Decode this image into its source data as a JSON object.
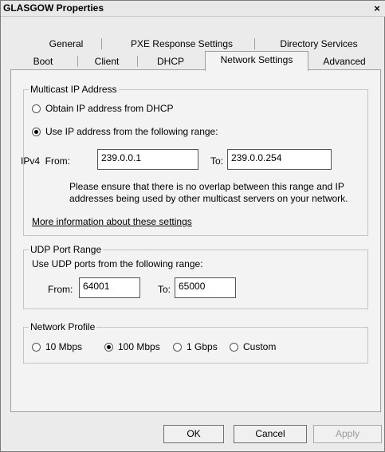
{
  "window": {
    "title": "GLASGOW Properties",
    "close_glyph": "×"
  },
  "tabs_row1": [
    {
      "label": "General"
    },
    {
      "label": "PXE Response Settings"
    },
    {
      "label": "Directory Services"
    }
  ],
  "tabs_row2": [
    {
      "label": "Boot"
    },
    {
      "label": "Client"
    },
    {
      "label": "DHCP"
    },
    {
      "label": "Network Settings",
      "active": true
    },
    {
      "label": "Advanced"
    }
  ],
  "multicast": {
    "title": "Multicast IP Address",
    "option_dhcp": "Obtain IP address from DHCP",
    "option_range": "Use IP address from the following range:",
    "selected": "range",
    "ipv4_from_label": "IPv4  From:",
    "from_value": "239.0.0.1",
    "to_label": "To:",
    "to_value": "239.0.0.254",
    "note": "Please ensure that there is no overlap between this range and IP addresses being used by other multicast servers on your network.",
    "more_info_link": "More information about these settings"
  },
  "udp": {
    "title": "UDP Port Range",
    "instruction": "Use UDP ports from the following range:",
    "from_label": "From:",
    "from_value": "64001",
    "to_label": "To:",
    "to_value": "65000"
  },
  "profile": {
    "title": "Network Profile",
    "options": [
      "10 Mbps",
      "100 Mbps",
      "1 Gbps",
      "Custom"
    ],
    "selected": "100 Mbps"
  },
  "buttons": {
    "ok": "OK",
    "cancel": "Cancel",
    "apply": "Apply"
  }
}
